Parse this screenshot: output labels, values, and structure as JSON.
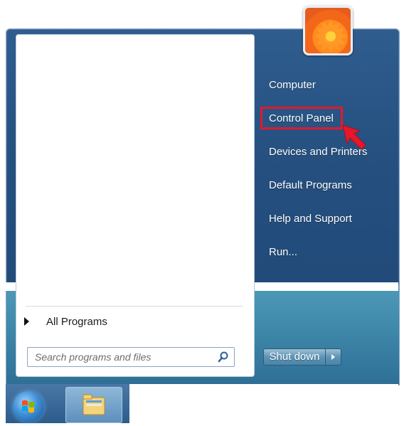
{
  "start_menu": {
    "all_programs_label": "All Programs",
    "search": {
      "placeholder": "Search programs and files"
    },
    "right_items": [
      {
        "label": "Computer"
      },
      {
        "label": "Control Panel",
        "highlighted": true
      },
      {
        "label": "Devices and Printers"
      },
      {
        "label": "Default Programs"
      },
      {
        "label": "Help and Support"
      },
      {
        "label": "Run..."
      }
    ],
    "shutdown_label": "Shut down",
    "user_picture_icon": "flower-icon"
  },
  "taskbar": {
    "start_button_icon": "windows-logo-icon",
    "pinned": [
      {
        "icon": "folder-icon"
      }
    ]
  },
  "colors": {
    "highlight_border": "#e5182b",
    "menu_blue": "#244f7f"
  }
}
